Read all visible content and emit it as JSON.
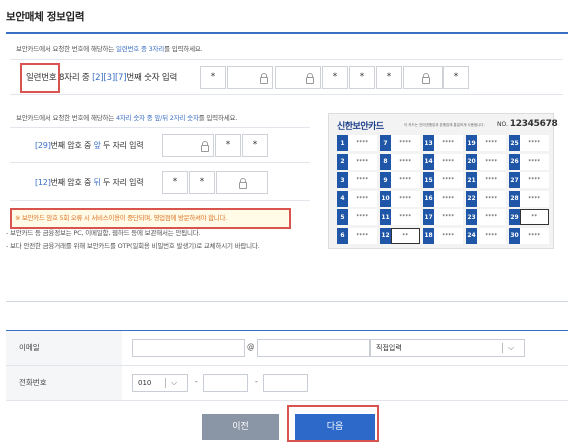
{
  "page_title": "보안매체 정보입력",
  "security_card": {
    "note_1_prefix": "보안카드에서 요청한 번호에 해당하는 ",
    "note_1_highlight": "일련번호 중 3자리",
    "note_1_suffix": "를 입력하세요.",
    "serial_row": {
      "label_serial": "일련번호",
      "label_mid": " 8자리 중 ",
      "label_positions": "[2][3][7]",
      "label_suffix": "번째 숫자 입력",
      "cells": [
        "*",
        "",
        "",
        "*",
        "*",
        "*",
        "",
        "*"
      ]
    },
    "note_2_prefix": "보안카드에서 요청한 번호에 해당하는 ",
    "note_2_highlight": "4자리 숫자 중 앞/뒤 2자리 숫자",
    "note_2_suffix": "를 입력하세요.",
    "pw_rows": [
      {
        "prefix": "[29]",
        "mid": "번째 암호 중 ",
        "which": "앞",
        "suffix": " 두 자리 입력",
        "cells": [
          "",
          "*",
          "*"
        ]
      },
      {
        "prefix": "[12]",
        "mid": "번째 암호 중 ",
        "which": "뒤",
        "suffix": " 두 자리 입력",
        "cells": [
          "*",
          "*",
          ""
        ]
      }
    ],
    "warning": "※ 보안카드 암호 5회 오류 시 서비스이용이 중단되며, 영업점에 방문하셔야 합니다.",
    "card_image": {
      "brand": "신한보안카드",
      "desc": "이 카드는 인터넷뱅킹과 폰뱅킹에 통일하게 사용됩니다.",
      "no_label": "NO.",
      "no_value": "12345678",
      "cells": [
        {
          "n": "1",
          "v": "****"
        },
        {
          "n": "7",
          "v": "****"
        },
        {
          "n": "13",
          "v": "****"
        },
        {
          "n": "19",
          "v": "****"
        },
        {
          "n": "25",
          "v": "****"
        },
        {
          "n": "2",
          "v": "****"
        },
        {
          "n": "8",
          "v": "****"
        },
        {
          "n": "14",
          "v": "****"
        },
        {
          "n": "20",
          "v": "****"
        },
        {
          "n": "26",
          "v": "****"
        },
        {
          "n": "3",
          "v": "****"
        },
        {
          "n": "9",
          "v": "****"
        },
        {
          "n": "15",
          "v": "****"
        },
        {
          "n": "21",
          "v": "****"
        },
        {
          "n": "27",
          "v": "****"
        },
        {
          "n": "4",
          "v": "****"
        },
        {
          "n": "10",
          "v": "****"
        },
        {
          "n": "16",
          "v": "****"
        },
        {
          "n": "22",
          "v": "****"
        },
        {
          "n": "28",
          "v": "****"
        },
        {
          "n": "5",
          "v": "****"
        },
        {
          "n": "11",
          "v": "****"
        },
        {
          "n": "17",
          "v": "****"
        },
        {
          "n": "23",
          "v": "****"
        },
        {
          "n": "29",
          "v": "**",
          "hl": true
        },
        {
          "n": "6",
          "v": "****"
        },
        {
          "n": "12",
          "v": "**",
          "hl": true
        },
        {
          "n": "18",
          "v": "****"
        },
        {
          "n": "24",
          "v": "****"
        },
        {
          "n": "30",
          "v": "****"
        }
      ]
    }
  },
  "bullets": [
    "- 보안카드 등 금융정보는 PC, 이메일함, 웹하드 등에 보관해서는 안됩니다.",
    "- 보다 안전한 금융거래를 위해 보안카드를 OTP(일회용 비밀번호 발생기)로 교체하시기 바랍니다."
  ],
  "form": {
    "email_label": "이메일",
    "email_at": "@",
    "email_domain_select": "직접입력",
    "phone_label": "전화번호",
    "phone_prefix_select": "010",
    "phone_dash": "-"
  },
  "buttons": {
    "prev": "이전",
    "next": "다음"
  },
  "colors": {
    "accent": "#3b6fc4",
    "highlight_box": "#d9534f",
    "warning_text": "#e0762c",
    "next_button": "#2c69c9",
    "prev_button": "#8a95a5"
  }
}
